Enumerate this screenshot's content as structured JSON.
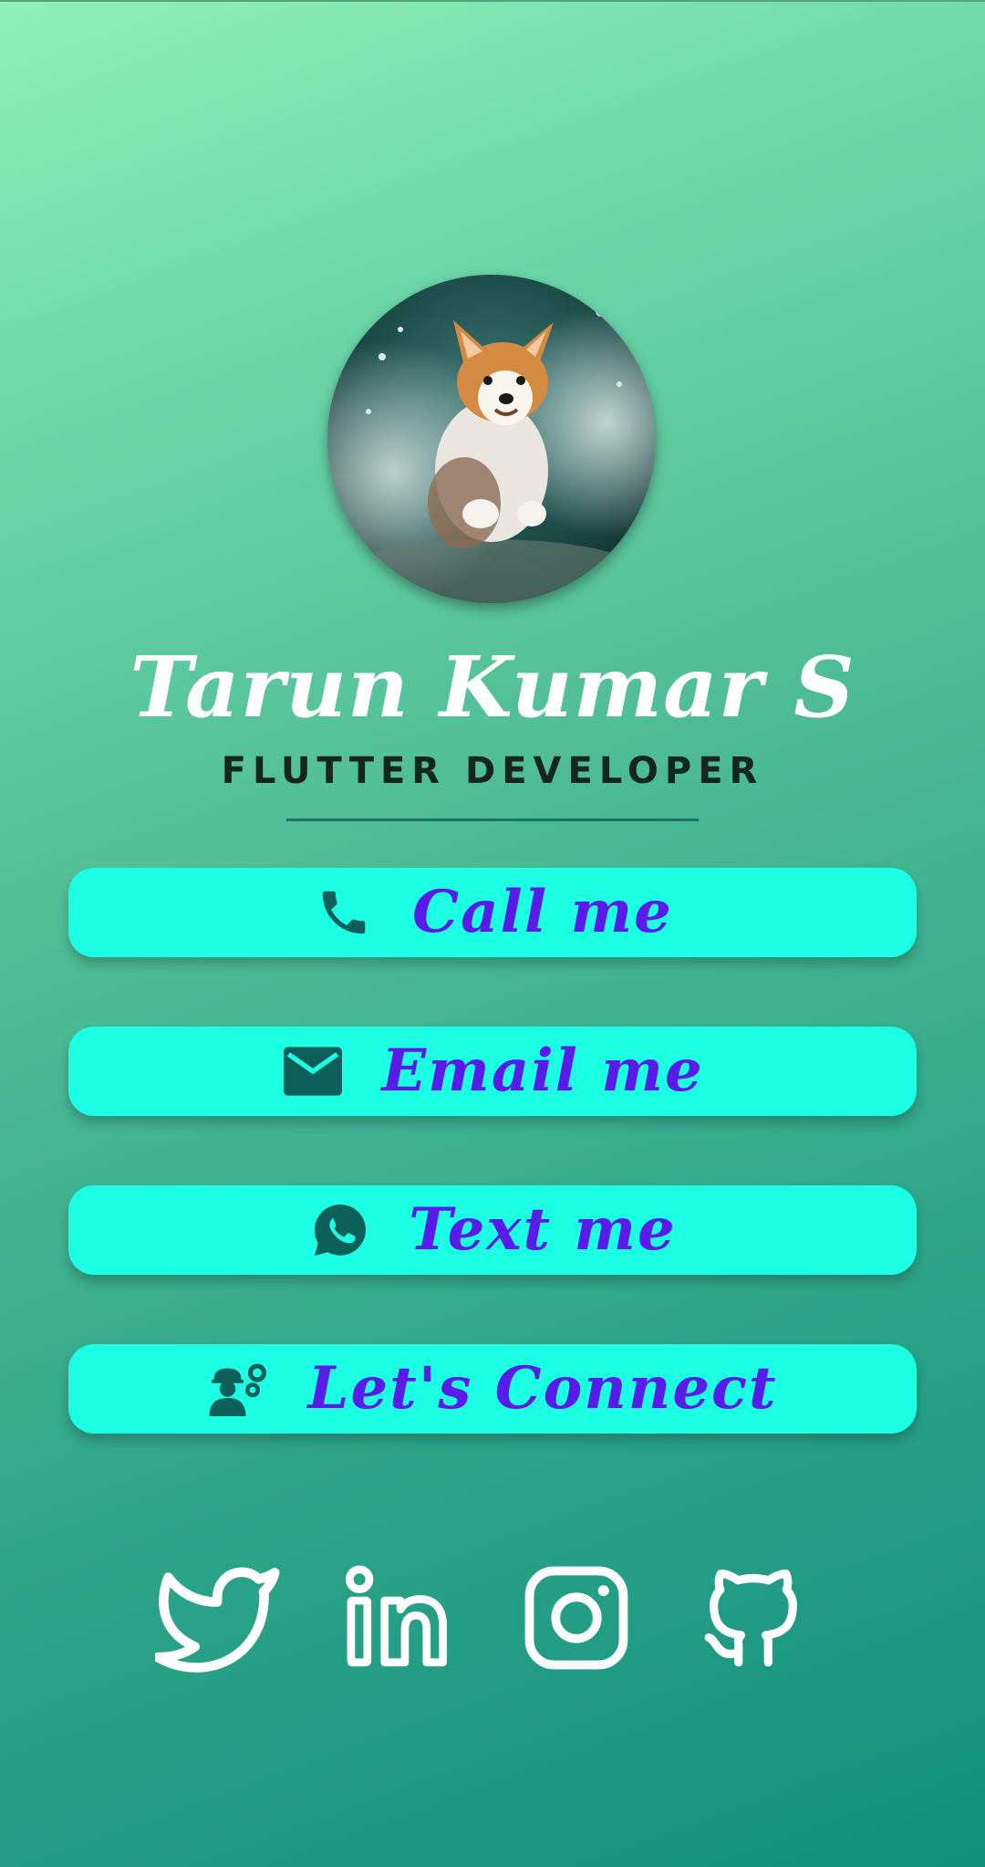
{
  "profile": {
    "name": "Tarun Kumar S",
    "title": "FLUTTER DEVELOPER",
    "avatar_icon": "corgi-photo"
  },
  "buttons": [
    {
      "label": "Call me",
      "icon": "phone-icon"
    },
    {
      "label": "Email me",
      "icon": "mail-icon"
    },
    {
      "label": "Text me",
      "icon": "whatsapp-icon"
    },
    {
      "label": "Let's Connect",
      "icon": "engineer-icon"
    }
  ],
  "social": [
    {
      "icon": "twitter-icon"
    },
    {
      "icon": "linkedin-icon"
    },
    {
      "icon": "instagram-icon"
    },
    {
      "icon": "github-icon"
    }
  ],
  "colors": {
    "button_bg": "#1cffe4",
    "button_text": "#5a1ae8",
    "icon_dark": "#0d5f5a",
    "name_text": "#ffffff",
    "title_text": "#14261f"
  }
}
